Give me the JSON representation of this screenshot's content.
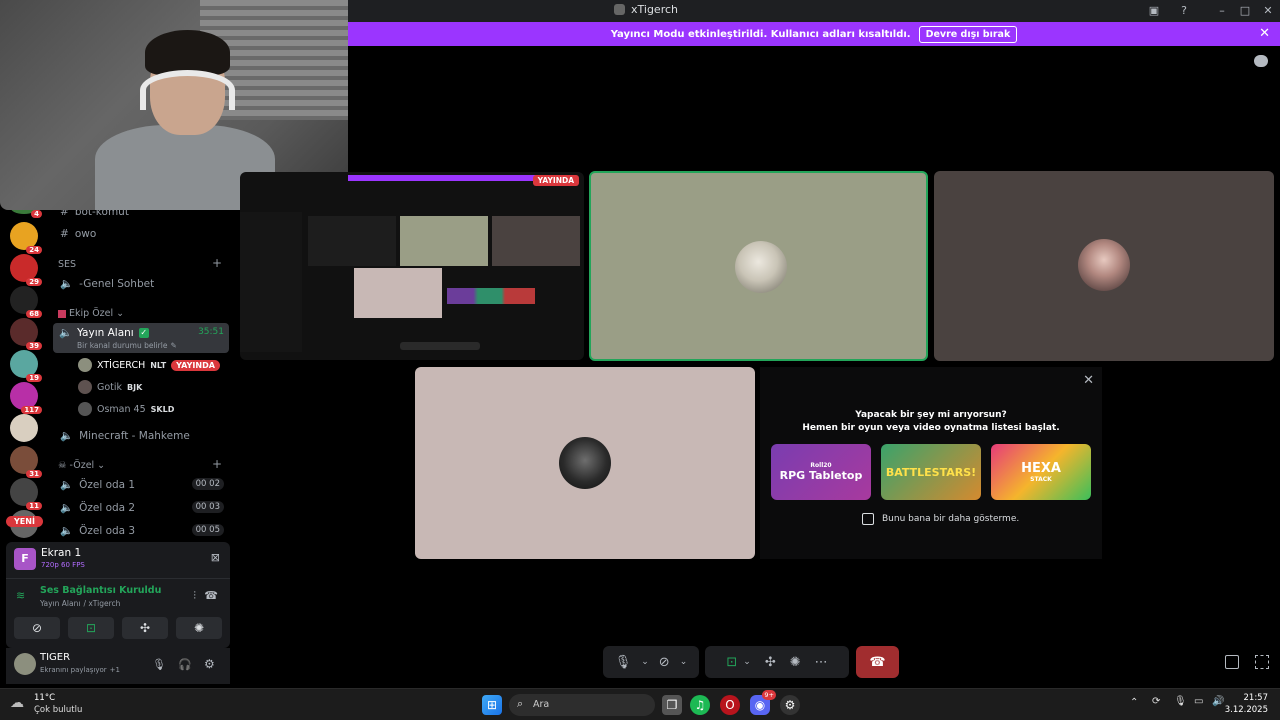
{
  "window": {
    "title": "xTigerch"
  },
  "banner": {
    "text": "Yayıncı Modu etkinleştirildi. Kullanıcı adları kısaltıldı.",
    "button_label": "Devre dışı bırak"
  },
  "servers": {
    "badges": [
      "24",
      "29",
      "68",
      "39",
      "19",
      "117",
      "31",
      "11"
    ],
    "partial_badge": "4",
    "new_label": "YENİ"
  },
  "channels": {
    "text_channels": [
      "bot-komut",
      "owo"
    ],
    "voice_category": "SES",
    "general_voice": "-Genel Sohbet",
    "ekip_category": "Ekip Özel",
    "active_channel": {
      "name": "Yayın Alanı",
      "timer": "35:51",
      "status_prompt": "Bir kanal durumu belirle"
    },
    "voice_users": [
      {
        "name": "XTİGERCH",
        "tag": "NLT",
        "live": "YAYINDA"
      },
      {
        "name": "Gotik",
        "tag": "BJK"
      },
      {
        "name": "Osman 45",
        "tag": "SKLD"
      }
    ],
    "other_voice": "Minecraft - Mahkeme",
    "ozel_category": "-Özel",
    "private_rooms": [
      {
        "name": "Özel oda 1",
        "count_a": "00",
        "count_b": "02"
      },
      {
        "name": "Özel oda 2",
        "count_a": "00",
        "count_b": "03"
      },
      {
        "name": "Özel oda 3",
        "count_a": "00",
        "count_b": "05"
      }
    ]
  },
  "screen_share": {
    "title": "Ekran 1",
    "quality": "720p 60 FPS",
    "letter": "F"
  },
  "voice_status": {
    "title": "Ses Bağlantısı Kuruldu",
    "channel": "Yayın Alanı",
    "server": "/ xTigerch"
  },
  "user": {
    "name": "TIGER",
    "status": "Ekranını paylaşıyor",
    "extra": "+1"
  },
  "stream_preview": {
    "live_badge": "YAYINDA"
  },
  "activity": {
    "line1": "Yapacak bir şey mi arıyorsun?",
    "line2": "Hemen bir oyun veya video oynatma listesi başlat.",
    "games": [
      "RPG Tabletop",
      "BATTLESTARS!",
      "HEXA"
    ],
    "game1_brand": "Roll20",
    "game3_sub": "STACK",
    "checkbox_label": "Bunu bana bir daha gösterme."
  },
  "taskbar": {
    "weather_temp": "11°C",
    "weather_desc": "Çok bulutlu",
    "search_placeholder": "Ara",
    "discord_badge": "9+",
    "time": "21:57",
    "date": "3.12.2025"
  },
  "colors": {
    "accent_purple": "#9b35ff",
    "live_red": "#da373c",
    "connected_green": "#23a55a",
    "end_call_red": "#a12d2f",
    "tile_tiger_bg": "#9a9e86",
    "tile_user2_bg": "#4a4240",
    "tile_user3_bg": "#c8b8b5"
  }
}
